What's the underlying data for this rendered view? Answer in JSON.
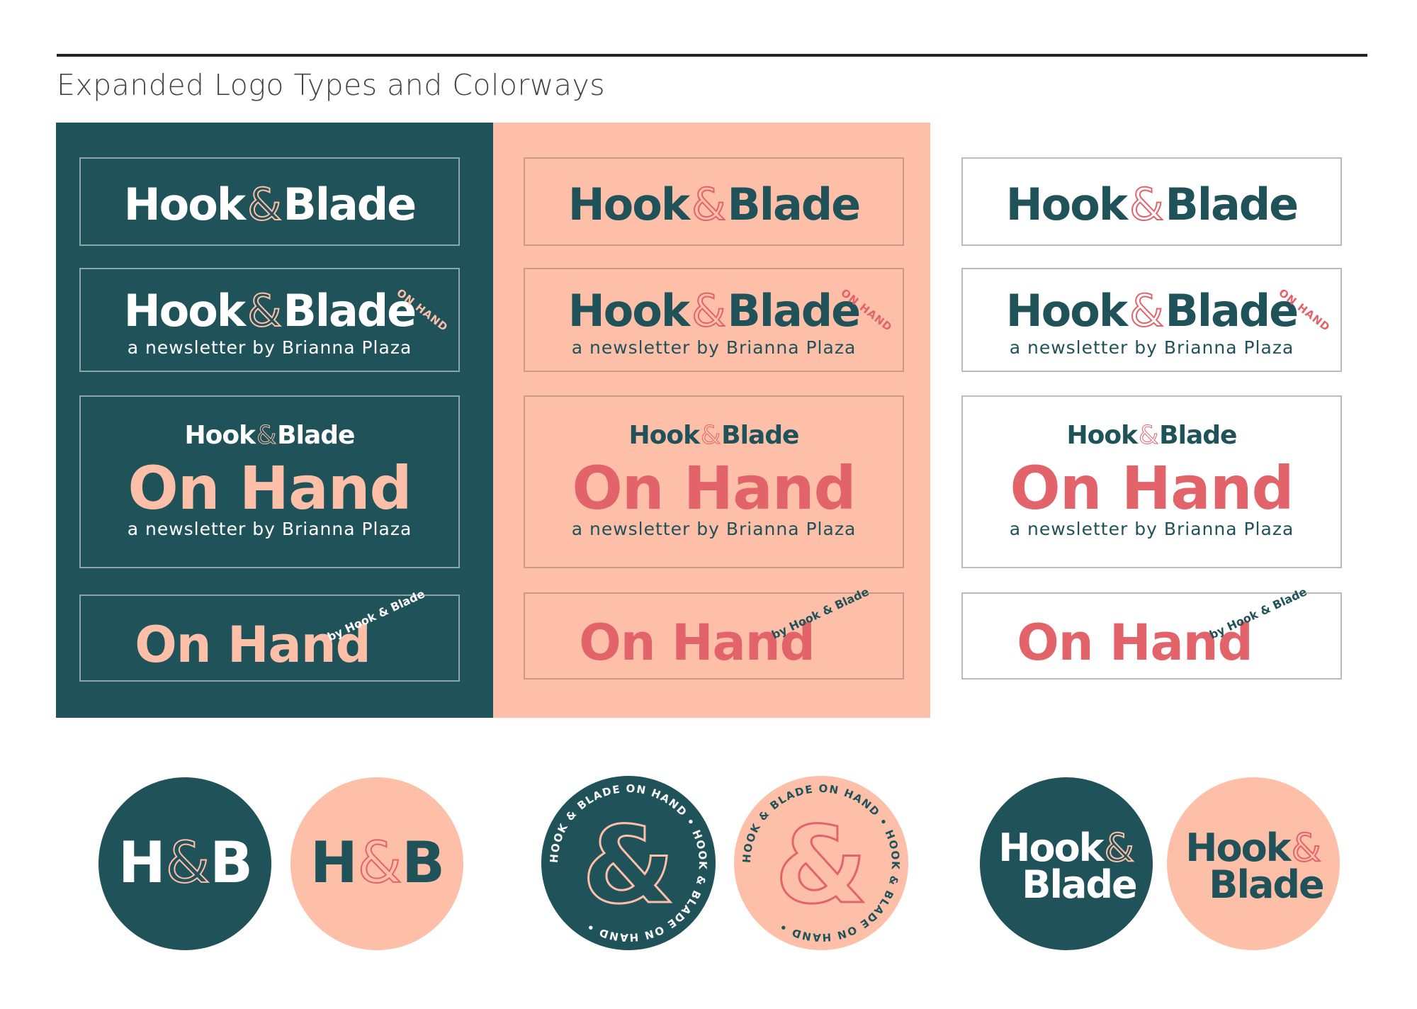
{
  "page": {
    "heading": "Expanded Logo Types and Colorways"
  },
  "colors": {
    "teal": "#1f5259",
    "peach": "#febfa8",
    "coral": "#e2636a",
    "white": "#ffffff"
  },
  "logo": {
    "hook": "Hook",
    "amp": "&",
    "blade": "Blade",
    "on_hand": "On Hand",
    "on_hand_upper": "ON HAND",
    "tagline": "a newsletter by Brianna Plaza",
    "by_hook_blade": "by Hook & Blade",
    "monogram_h": "H",
    "monogram_b": "B",
    "seal_ring_text": "HOOK & BLADE ON HAND • HOOK & BLADE ON HAND •"
  }
}
